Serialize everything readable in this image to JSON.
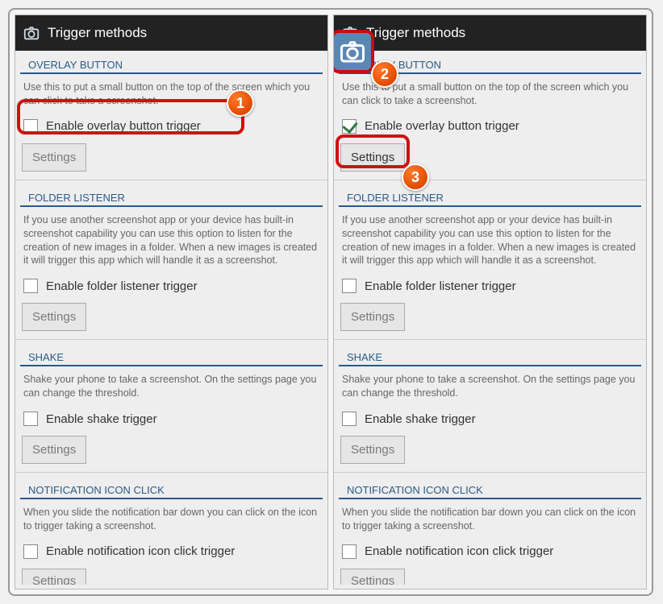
{
  "title": "Trigger methods",
  "sections": {
    "overlay": {
      "header": "OVERLAY BUTTON",
      "desc": "Use this to put a small button on the top of the screen which you can click to take a screenshot.",
      "checkbox_label": "Enable overlay button trigger",
      "settings": "Settings"
    },
    "folder": {
      "header": "FOLDER LISTENER",
      "desc": "If you use another screenshot app or your device has built-in screenshot capability you can use this option to listen for the creation of new images in a folder. When a new images is created it will trigger this app which will handle it as a screenshot.",
      "checkbox_label": "Enable folder listener trigger",
      "settings": "Settings"
    },
    "shake": {
      "header": "SHAKE",
      "desc": "Shake your phone to take a screenshot. On the settings page you can change the threshold.",
      "checkbox_label": "Enable shake trigger",
      "settings": "Settings"
    },
    "notif": {
      "header": "NOTIFICATION ICON CLICK",
      "desc": "When you slide the notification bar down you can click on the icon to trigger taking a screenshot.",
      "checkbox_label": "Enable notification icon click trigger",
      "settings": "Settings"
    }
  },
  "badges": {
    "n1": "1",
    "n2": "2",
    "n3": "3"
  }
}
